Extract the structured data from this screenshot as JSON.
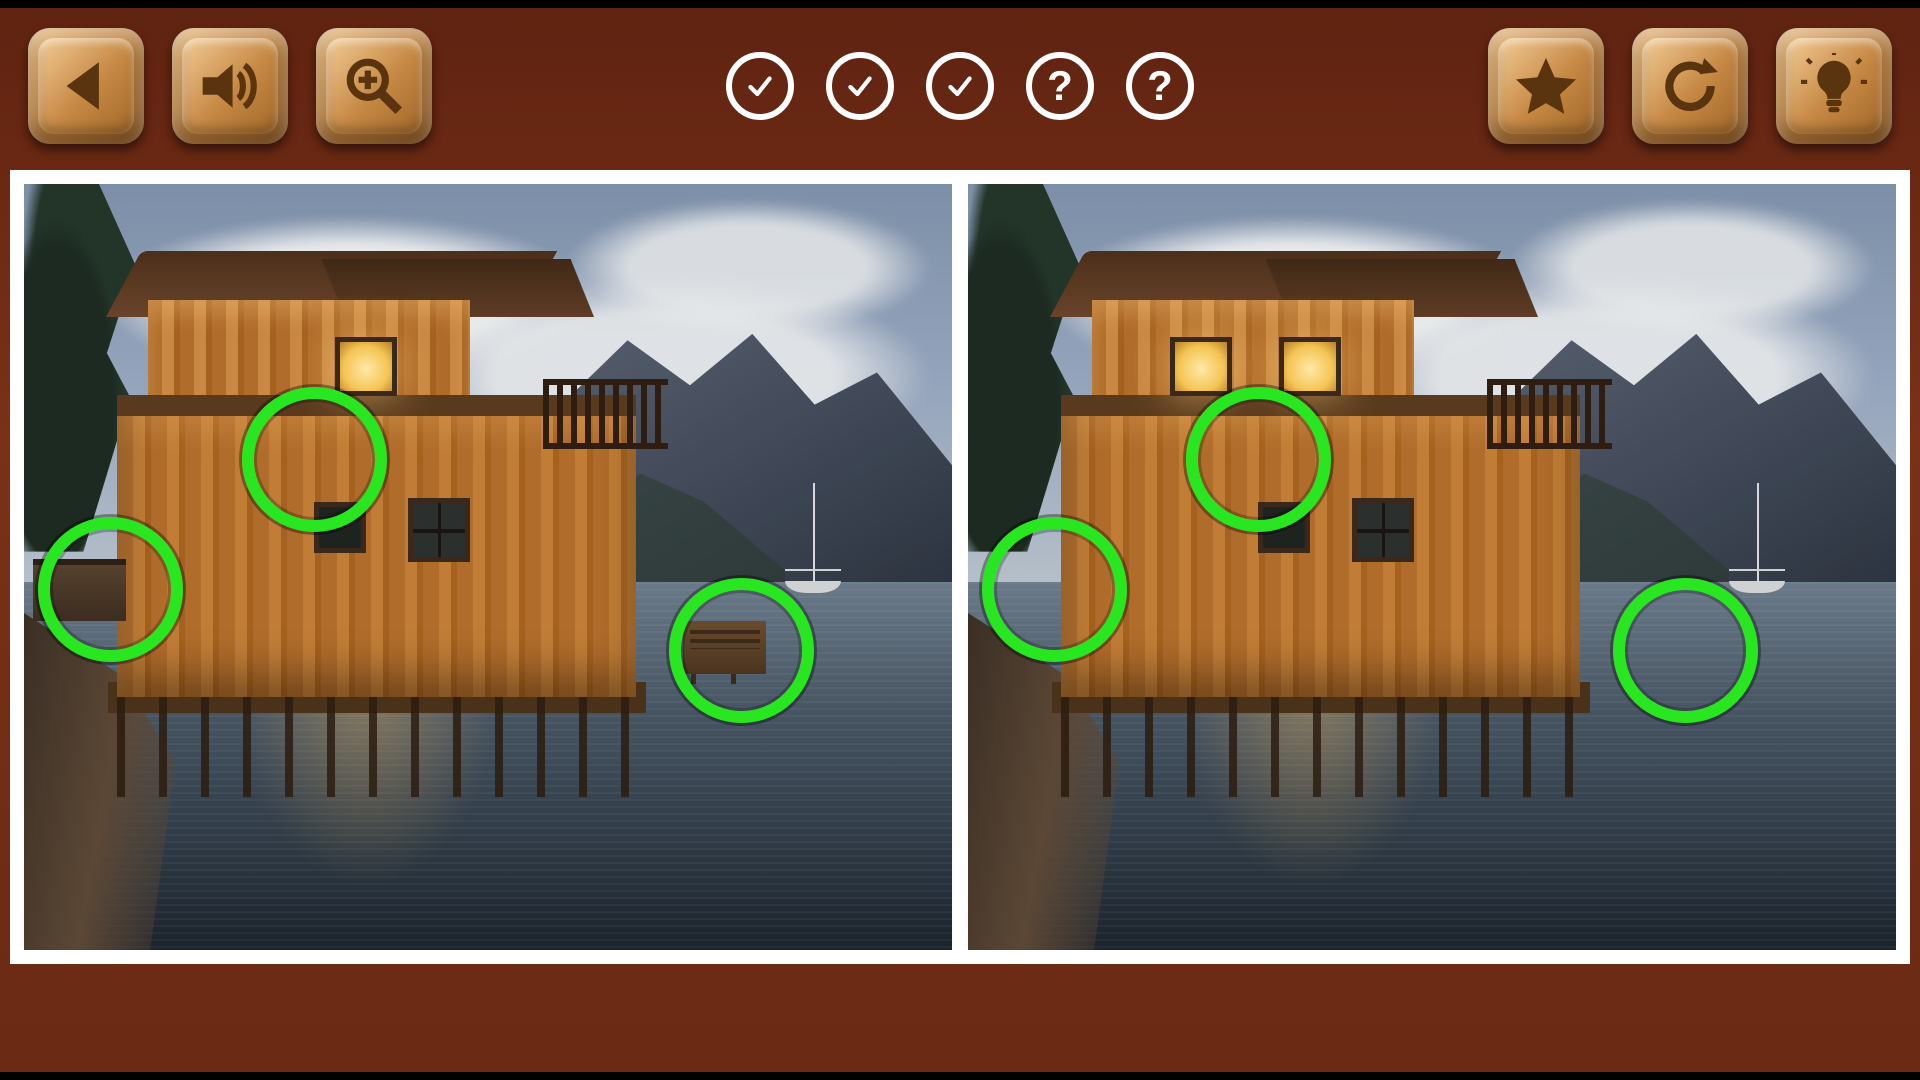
{
  "theme": {
    "background": "#6a2a14",
    "button_face": "#d79a52",
    "button_icon": "#5a340f",
    "progress_ring": "#ffffff",
    "marker_color": "#28e61f"
  },
  "toolbar": {
    "left": [
      {
        "name": "back-button",
        "icon": "triangle-left"
      },
      {
        "name": "sound-button",
        "icon": "speaker"
      },
      {
        "name": "zoom-button",
        "icon": "magnifier-plus"
      }
    ],
    "right": [
      {
        "name": "favorite-button",
        "icon": "star"
      },
      {
        "name": "reload-button",
        "icon": "refresh"
      },
      {
        "name": "hint-button",
        "icon": "lightbulb"
      }
    ]
  },
  "progress": {
    "total": 5,
    "found_symbol": "✓",
    "remaining_symbol": "?",
    "items": [
      {
        "state": "found"
      },
      {
        "state": "found"
      },
      {
        "state": "found"
      },
      {
        "state": "remaining"
      },
      {
        "state": "remaining"
      }
    ]
  },
  "scene": {
    "description": "Wooden lakeside boathouse at dusk with mountain backdrop and sailboat",
    "differences_present": {
      "extra_upper_window": {
        "left_panel": false,
        "right_panel": true
      },
      "far_shore_cabin": {
        "left_panel": true,
        "right_panel": false
      },
      "waterside_bench": {
        "left_panel": true,
        "right_panel": false
      }
    }
  },
  "markers": {
    "radius_pct": 6.5,
    "positions_pct": [
      {
        "id": "upper-window-spot",
        "x": 30,
        "y": 33
      },
      {
        "id": "far-cabin-spot",
        "x": 8,
        "y": 50
      },
      {
        "id": "bench-spot",
        "x": 76,
        "y": 58
      }
    ]
  }
}
